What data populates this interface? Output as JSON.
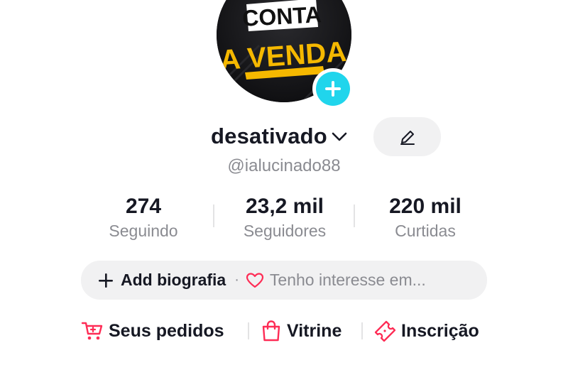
{
  "profile": {
    "avatar_text_top": "CONTA",
    "avatar_text_bottom": "A VENDA",
    "display_name": "desativado",
    "username": "@ialucinado88"
  },
  "stats": [
    {
      "value": "274",
      "label": "Seguindo"
    },
    {
      "value": "23,2 mil",
      "label": "Seguidores"
    },
    {
      "value": "220 mil",
      "label": "Curtidas"
    }
  ],
  "bio": {
    "add_label": "Add biografia",
    "separator": "·",
    "interest_label": "Tenho interesse em..."
  },
  "shop": {
    "orders_label": "Seus pedidos",
    "showcase_label": "Vitrine",
    "subscription_label": "Inscrição"
  },
  "colors": {
    "accent_cyan": "#20d5ec",
    "shop_pink": "#fe2c55",
    "text_primary": "#161823",
    "text_secondary": "#8a8b91",
    "pill_bg": "#f1f1f2"
  },
  "icons": {
    "avatar_add": "plus-icon",
    "name_dropdown": "chevron-down-icon",
    "edit": "pencil-icon",
    "bio_add": "plus-icon",
    "interest": "heart-icon",
    "orders": "cart-icon",
    "showcase": "shopping-bag-icon",
    "subscription": "ticket-icon"
  }
}
